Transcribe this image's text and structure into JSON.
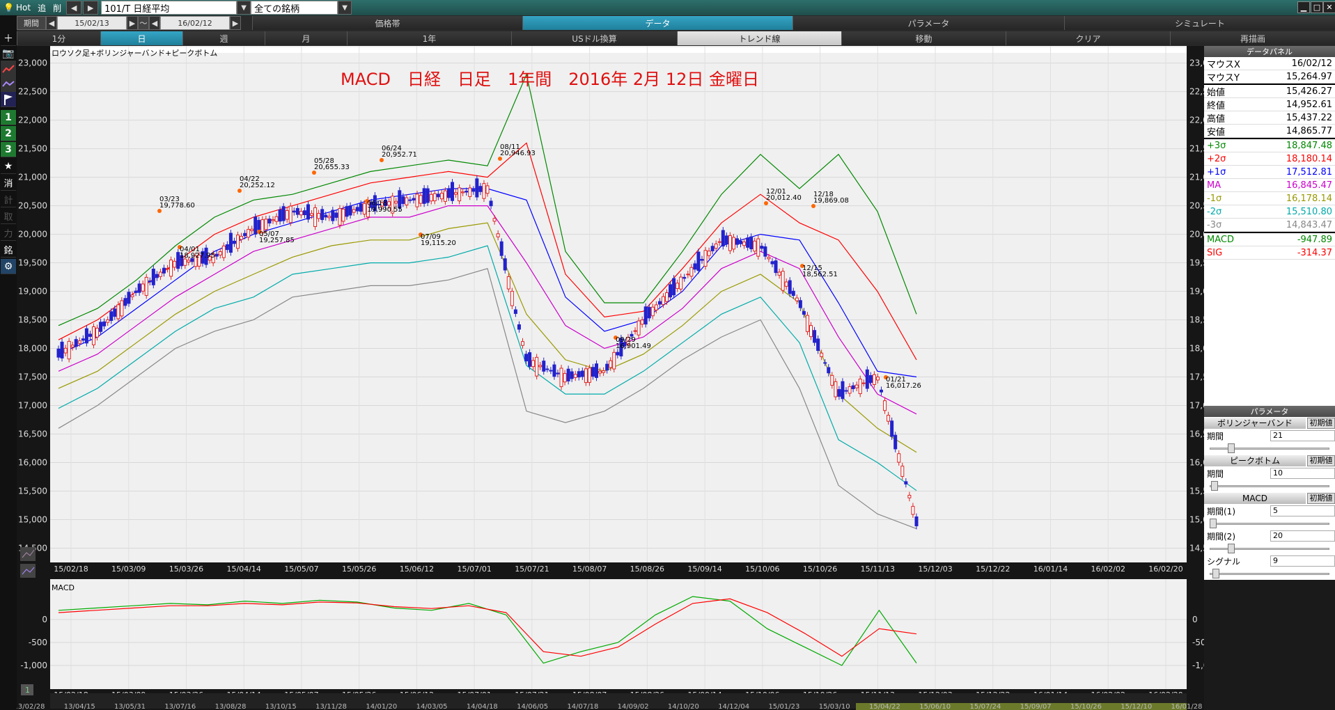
{
  "toolbar": {
    "hot": "Hot",
    "add": "追",
    "del": "削",
    "symbol": "101/T 日経平均",
    "filter": "全ての銘柄"
  },
  "period": {
    "label": "期間",
    "from": "15/02/13",
    "sep": "～",
    "to": "16/02/12"
  },
  "tabs_top": [
    "価格帯",
    "データ",
    "パラメータ",
    "シミュレート"
  ],
  "tabs_mid": [
    "1分",
    "日",
    "週",
    "月",
    "1年",
    "USドル換算",
    "トレンド線",
    "移動",
    "クリア",
    "再描画"
  ],
  "chart": {
    "subtitle": "ロウソク足+ボリンジャーバンド+ピークボトム",
    "title": "MACD　日経　日足　1年間　2016年 2月 12日 金曜日",
    "yticks": [
      "23,000",
      "22,500",
      "22,000",
      "21,500",
      "21,000",
      "20,500",
      "20,000",
      "19,500",
      "19,000",
      "18,500",
      "18,000",
      "17,500",
      "17,000",
      "16,500",
      "16,000",
      "15,500",
      "15,000",
      "14,500"
    ],
    "xticks": [
      "15/02/18",
      "15/03/09",
      "15/03/26",
      "15/04/14",
      "15/05/07",
      "15/05/26",
      "15/06/12",
      "15/07/01",
      "15/07/21",
      "15/08/07",
      "15/08/26",
      "15/09/14",
      "15/10/06",
      "15/10/26",
      "15/11/13",
      "15/12/03",
      "15/12/22",
      "16/01/14",
      "16/02/02",
      "16/02/20"
    ],
    "peaks": [
      {
        "date": "03/23",
        "value": "19,778.60"
      },
      {
        "date": "04/22",
        "value": "20,252.12"
      },
      {
        "date": "05/28",
        "value": "20,655.33"
      },
      {
        "date": "06/24",
        "value": "20,952.71"
      },
      {
        "date": "08/11",
        "value": "20,946.93"
      },
      {
        "date": "12/01",
        "value": "20,012.40"
      },
      {
        "date": "12/18",
        "value": "19,869.08"
      }
    ],
    "bottoms": [
      {
        "date": "04/01",
        "value": "18,927.95"
      },
      {
        "date": "05/07",
        "value": "19,257.85"
      },
      {
        "date": "06/18",
        "value": "19,990.55"
      },
      {
        "date": "07/09",
        "value": "19,115.20"
      },
      {
        "date": "09/29",
        "value": "16,901.49"
      },
      {
        "date": "12/15",
        "value": "18,562.51"
      },
      {
        "date": "01/21",
        "value": "16,017.26"
      }
    ],
    "macd_label": "MACD",
    "macd_yticks": [
      "0",
      "-500",
      "-1,000"
    ],
    "bottom_dates": [
      "13/02/28",
      "13/04/15",
      "13/05/31",
      "13/07/16",
      "13/08/28",
      "13/10/15",
      "13/11/28",
      "14/01/20",
      "14/03/05",
      "14/04/18",
      "14/06/05",
      "14/07/18",
      "14/09/02",
      "14/10/20",
      "14/12/04",
      "15/01/23",
      "15/03/10",
      "15/04/22",
      "15/06/10",
      "15/07/24",
      "15/09/07",
      "15/10/26",
      "15/12/10",
      "16/01/28"
    ]
  },
  "chart_data": {
    "type": "line",
    "title": "MACD　日経　日足　1年間　2016年 2月 12日 金曜日",
    "ylim": [
      14250,
      23300
    ],
    "series": [
      {
        "name": "+3σ",
        "color": "#008800",
        "values": [
          18400,
          18700,
          19200,
          19800,
          20300,
          20600,
          20700,
          20900,
          21100,
          21200,
          21300,
          21200,
          22800,
          19700,
          18800,
          18800,
          19700,
          20700,
          21400,
          20800,
          21400,
          20400,
          18600
        ]
      },
      {
        "name": "+2σ",
        "color": "#ff0000",
        "values": [
          18150,
          18500,
          19000,
          19500,
          20000,
          20300,
          20500,
          20700,
          20900,
          21000,
          21100,
          21000,
          21600,
          19300,
          18550,
          18650,
          19400,
          20200,
          20700,
          20200,
          19900,
          19000,
          17800
        ]
      },
      {
        "name": "+1σ",
        "color": "#0000ff",
        "values": [
          17900,
          18200,
          18700,
          19200,
          19700,
          20000,
          20200,
          20400,
          20600,
          20700,
          20800,
          20800,
          20600,
          18900,
          18300,
          18500,
          19000,
          19800,
          20000,
          19900,
          18800,
          17600,
          17500
        ]
      },
      {
        "name": "MA",
        "color": "#cc00cc",
        "values": [
          17600,
          17900,
          18400,
          18900,
          19300,
          19700,
          19900,
          20100,
          20300,
          20300,
          20500,
          20500,
          19500,
          18400,
          18000,
          18200,
          18700,
          19400,
          19700,
          19400,
          18200,
          17200,
          16850
        ]
      },
      {
        "name": "-1σ",
        "color": "#999900",
        "values": [
          17300,
          17600,
          18100,
          18600,
          19000,
          19300,
          19600,
          19800,
          19900,
          19900,
          20100,
          20200,
          18600,
          17800,
          17600,
          17900,
          18400,
          19000,
          19300,
          18800,
          17200,
          16600,
          16180
        ]
      },
      {
        "name": "-2σ",
        "color": "#00aaaa",
        "values": [
          16950,
          17300,
          17800,
          18300,
          18700,
          18900,
          19300,
          19400,
          19500,
          19500,
          19600,
          19800,
          17700,
          17200,
          17200,
          17600,
          18100,
          18600,
          18900,
          18100,
          16400,
          16000,
          15510
        ]
      },
      {
        "name": "-3σ",
        "color": "#888888",
        "values": [
          16600,
          17000,
          17500,
          18000,
          18300,
          18500,
          18900,
          19000,
          19100,
          19100,
          19200,
          19400,
          16900,
          16700,
          16900,
          17300,
          17800,
          18200,
          18500,
          17300,
          15600,
          15100,
          14840
        ]
      },
      {
        "name": "Close",
        "color": "#0000cc",
        "values": [
          17900,
          18300,
          19000,
          19500,
          19600,
          20100,
          20400,
          20300,
          20500,
          20600,
          20700,
          20800,
          17800,
          17500,
          17600,
          18500,
          19200,
          19900,
          19800,
          18800,
          17200,
          17500,
          14950
        ]
      }
    ],
    "macd": [
      {
        "name": "MACD",
        "color": "#00aa00",
        "values": [
          200,
          250,
          300,
          350,
          320,
          400,
          350,
          420,
          380,
          250,
          200,
          350,
          100,
          -950,
          -700,
          -500,
          100,
          500,
          400,
          -200,
          -600,
          -1000,
          200,
          -948
        ]
      },
      {
        "name": "SIG",
        "color": "#ff0000",
        "values": [
          150,
          200,
          250,
          300,
          300,
          350,
          320,
          380,
          360,
          280,
          240,
          300,
          150,
          -700,
          -800,
          -600,
          -100,
          350,
          450,
          150,
          -300,
          -800,
          -200,
          -314
        ]
      }
    ]
  },
  "panel": {
    "header": "データパネル",
    "rows1": [
      [
        "マウスX",
        "16/02/12"
      ],
      [
        "マウスY",
        "15,264.97"
      ]
    ],
    "rows2": [
      [
        "始値",
        "15,426.27"
      ],
      [
        "終値",
        "14,952.61"
      ],
      [
        "高値",
        "15,437.22"
      ],
      [
        "安値",
        "14,865.77"
      ]
    ],
    "rows3": [
      [
        "+3σ",
        "18,847.48",
        "#008800"
      ],
      [
        "+2σ",
        "18,180.14",
        "#ff0000"
      ],
      [
        "+1σ",
        "17,512.81",
        "#0000ff"
      ],
      [
        "MA",
        "16,845.47",
        "#cc00cc"
      ],
      [
        "-1σ",
        "16,178.14",
        "#999900"
      ],
      [
        "-2σ",
        "15,510.80",
        "#00aaaa"
      ],
      [
        "-3σ",
        "14,843.47",
        "#888888"
      ]
    ],
    "rows4": [
      [
        "MACD",
        "-947.89",
        "#008800"
      ],
      [
        "SIG",
        "-314.37",
        "#ff0000"
      ]
    ],
    "param_header": "パラメータ",
    "bb": "ボリンジャーバンド",
    "reset": "初期値",
    "period_label": "期間",
    "bb_period": "21",
    "pb": "ピークボトム",
    "pb_period": "10",
    "macd": "MACD",
    "p1_label": "期間(1)",
    "p1": "5",
    "p2_label": "期間(2)",
    "p2": "20",
    "sig_label": "シグナル",
    "sig": "9"
  }
}
